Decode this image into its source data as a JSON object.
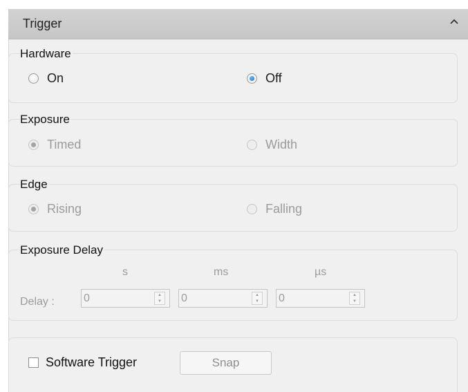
{
  "panel": {
    "title": "Trigger"
  },
  "hardware": {
    "legend": "Hardware",
    "on_label": "On",
    "off_label": "Off",
    "selected": "Off"
  },
  "exposure": {
    "legend": "Exposure",
    "timed_label": "Timed",
    "width_label": "Width",
    "selected": "Timed",
    "enabled": false
  },
  "edge": {
    "legend": "Edge",
    "rising_label": "Rising",
    "falling_label": "Falling",
    "selected": "Rising",
    "enabled": false
  },
  "exposure_delay": {
    "legend": "Exposure Delay",
    "delay_label": "Delay :",
    "units": {
      "s": "s",
      "ms": "ms",
      "us": "µs"
    },
    "values": {
      "s": "0",
      "ms": "0",
      "us": "0"
    }
  },
  "software": {
    "checkbox_label": "Software Trigger",
    "checked": false,
    "snap_label": "Snap"
  },
  "colors": {
    "accent": "#1b6fc8",
    "header_bg": "#cbcbcb",
    "disabled_text": "#9b9b9b",
    "panel_bg": "#f0f0f0"
  }
}
